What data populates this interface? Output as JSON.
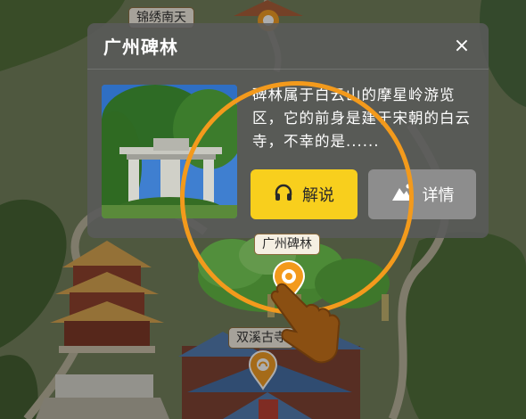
{
  "map": {
    "labels": {
      "top": "锦绣南天",
      "stele": "广州碑林",
      "temple": "双溪古寺"
    }
  },
  "popup": {
    "title": "广州碑林",
    "close_label": "×",
    "description": "碑林属于白云山的摩星岭游览区，它的前身是建于宋朝的白云寺，不幸的是......",
    "audio_button_label": "解说",
    "detail_button_label": "详情"
  },
  "colors": {
    "accent_orange": "#f39a1c",
    "audio_button": "#f8cf1d",
    "detail_button": "#8d8d8d",
    "popup_bg": "#5a5a5a"
  },
  "icons": {
    "audio": "headphones-icon",
    "detail": "mountain-icon",
    "pin": "location-pin-icon",
    "pointer": "pointing-hand-icon"
  }
}
